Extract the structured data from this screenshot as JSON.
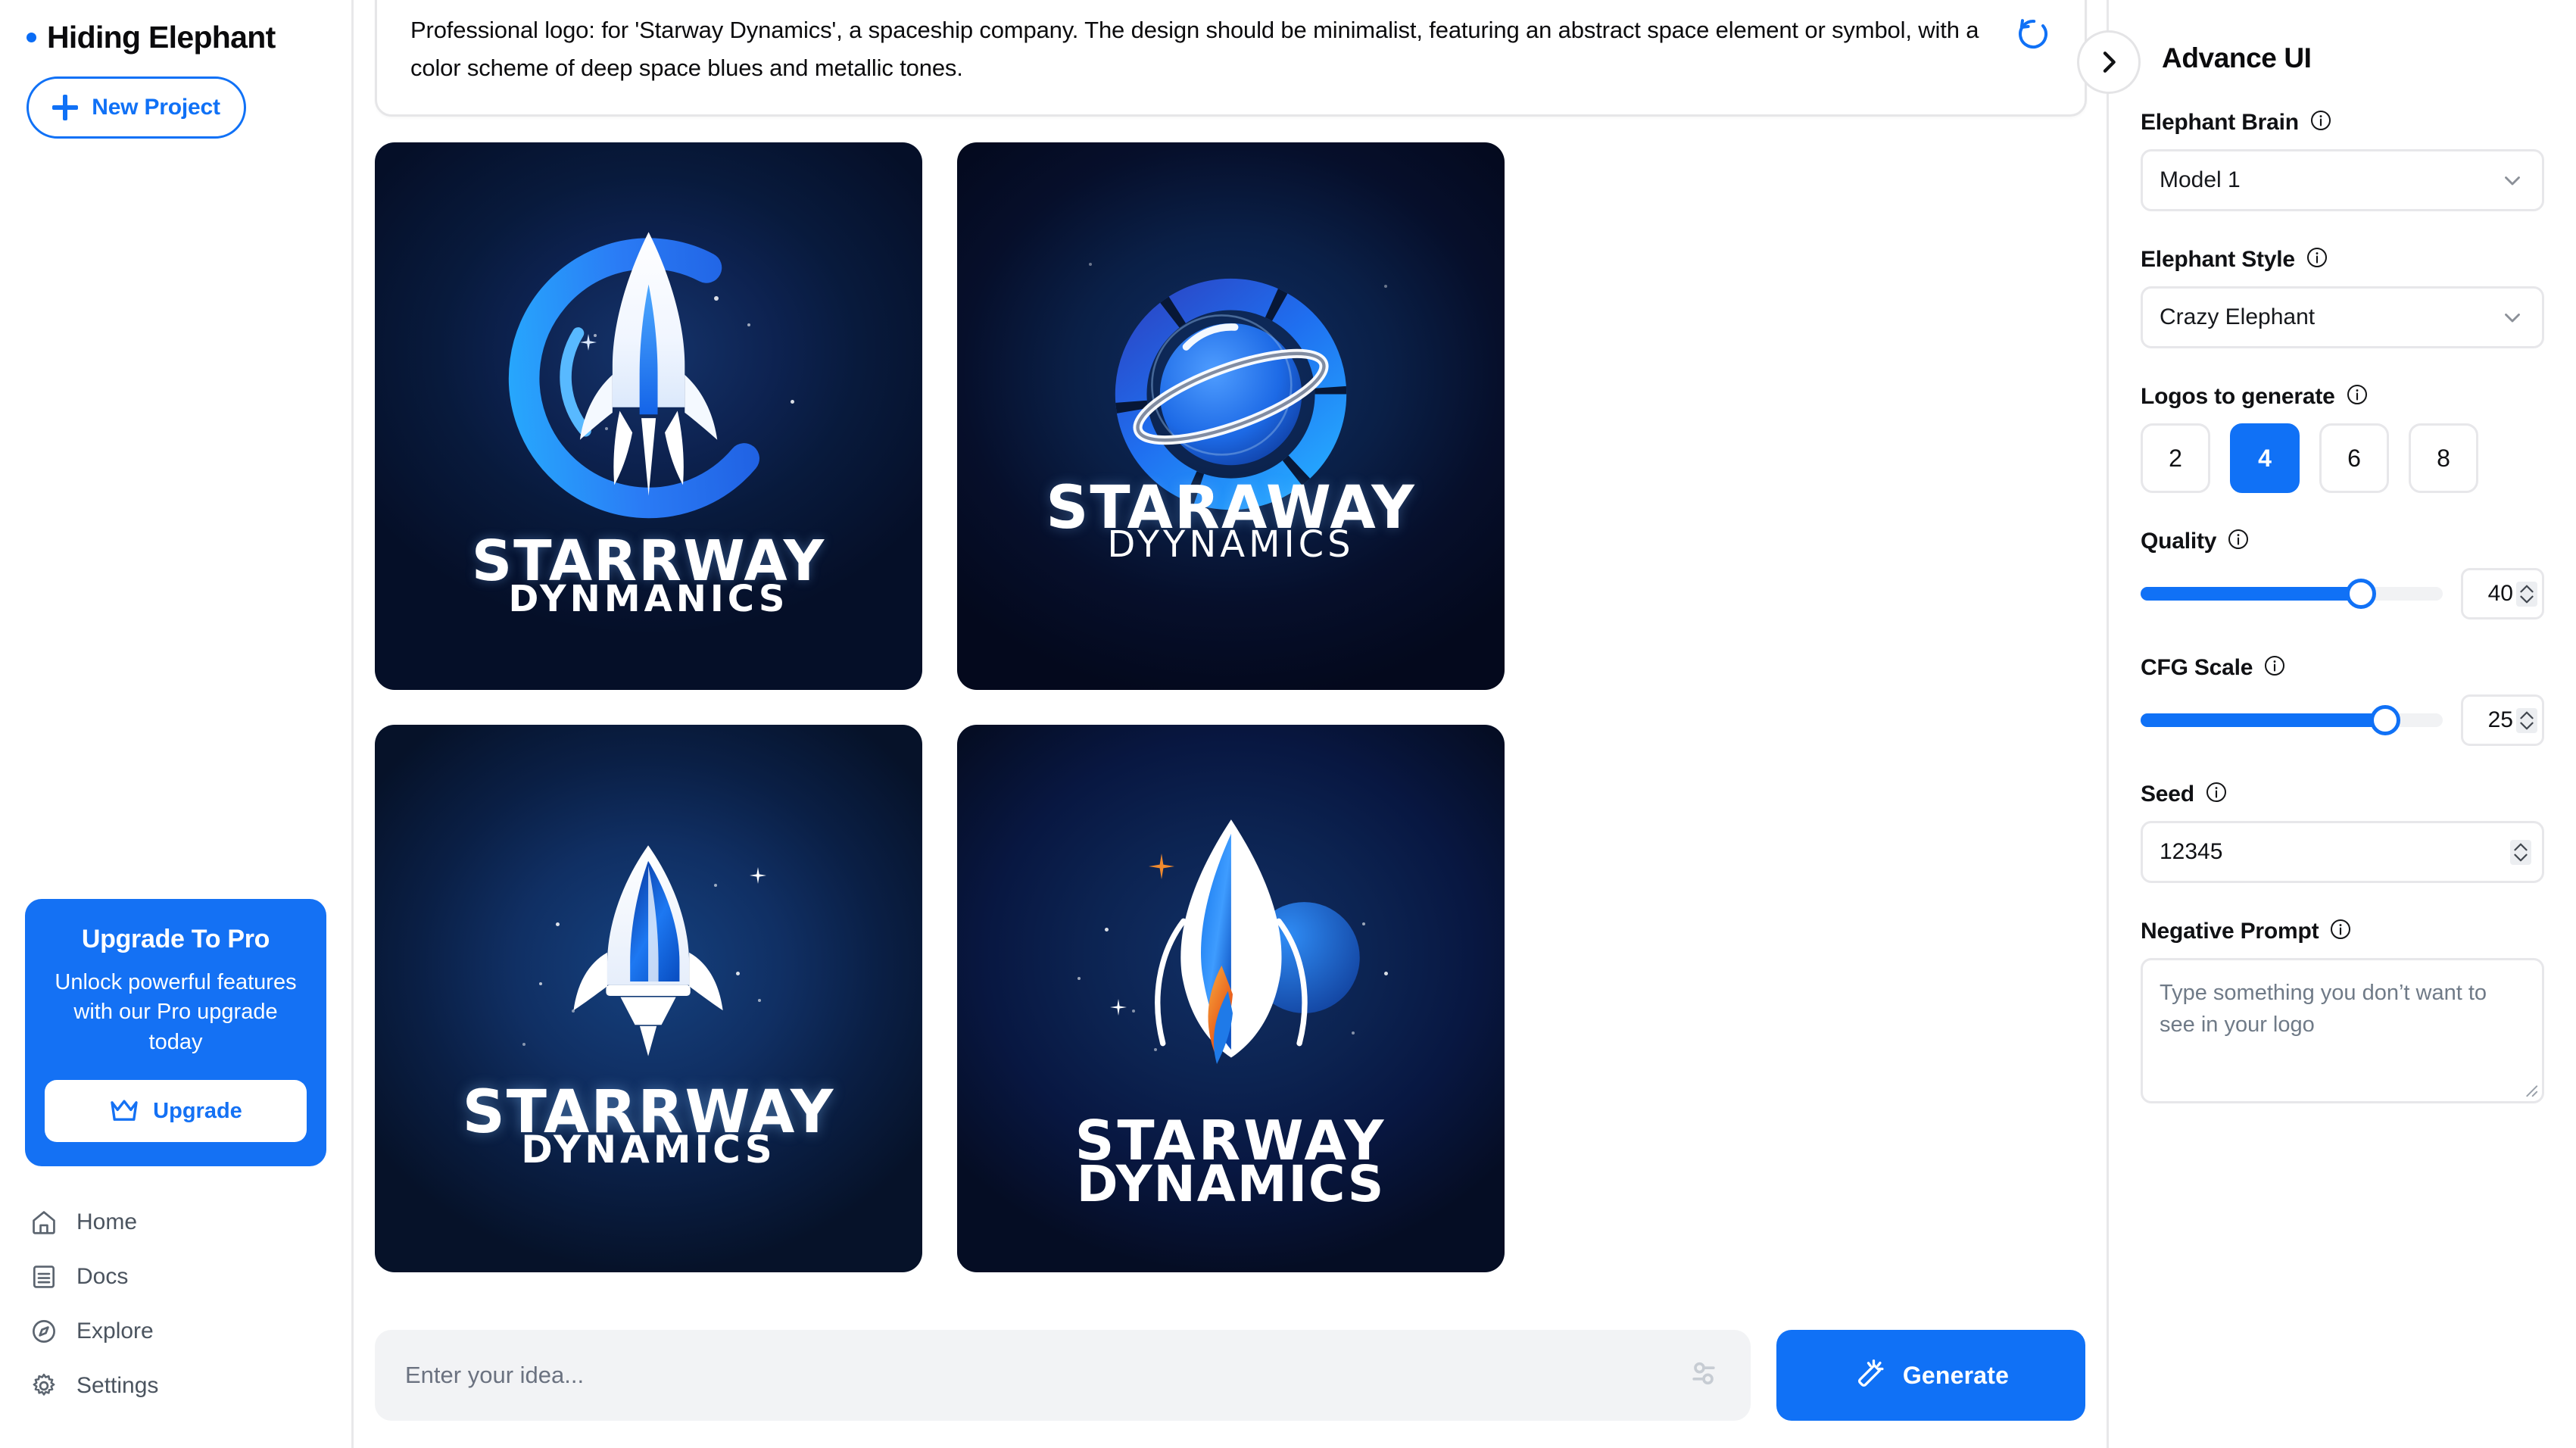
{
  "sidebar": {
    "brand": "Hiding Elephant",
    "new_project_label": "New Project",
    "upgrade": {
      "title": "Upgrade To Pro",
      "description": "Unlock powerful features with our Pro upgrade today",
      "button_label": "Upgrade"
    },
    "nav": [
      {
        "label": "Home",
        "icon": "home-icon"
      },
      {
        "label": "Docs",
        "icon": "docs-icon"
      },
      {
        "label": "Explore",
        "icon": "compass-icon"
      },
      {
        "label": "Settings",
        "icon": "gear-icon"
      }
    ]
  },
  "main": {
    "prompt_text": "Professional logo: for 'Starway Dynamics', a spaceship company. The design should be minimalist, featuring an abstract space element or symbol, with a color scheme of deep space blues and metallic tones.",
    "reset_icon": "reset-rotate-ccw-icon",
    "results": [
      {
        "wordmark_top": "STARRWAY",
        "wordmark_bottom": "DYNMANICS",
        "art": "rocket-crescent-ring"
      },
      {
        "wordmark_top": "STARAWAY",
        "wordmark_bottom": "DYYNAMICS",
        "art": "ringed-planet-orb"
      },
      {
        "wordmark_top": "STARRWAY",
        "wordmark_bottom": "DYNAMICS",
        "art": "slim-rocket-stars"
      },
      {
        "wordmark_top": "STARWAY",
        "wordmark_bottom": "DYNAMICS",
        "art": "flame-rocket-planet"
      }
    ],
    "idea_input": {
      "value": "",
      "placeholder": "Enter your idea...",
      "settings_icon": "sliders-icon"
    },
    "generate": {
      "label": "Generate",
      "icon": "magic-wand-icon"
    }
  },
  "right_panel": {
    "title": "Advance UI",
    "toggle_icon": "chevron-right-icon",
    "elephant_brain": {
      "label": "Elephant Brain",
      "value": "Model 1",
      "info_icon": "info-icon",
      "chevron": "chevron-down-icon"
    },
    "elephant_style": {
      "label": "Elephant Style",
      "value": "Crazy Elephant",
      "info_icon": "info-icon",
      "chevron": "chevron-down-icon"
    },
    "logos_to_generate": {
      "label": "Logos to generate",
      "info_icon": "info-icon",
      "options": [
        "2",
        "4",
        "6",
        "8"
      ],
      "selected": "4"
    },
    "quality": {
      "label": "Quality",
      "info_icon": "info-icon",
      "value": "40",
      "percent": 73
    },
    "cfg_scale": {
      "label": "CFG Scale",
      "info_icon": "info-icon",
      "value": "25",
      "percent": 81
    },
    "seed": {
      "label": "Seed",
      "info_icon": "info-icon",
      "value": "12345"
    },
    "negative_prompt": {
      "label": "Negative Prompt",
      "info_icon": "info-icon",
      "value": "",
      "placeholder": "Type something you don’t want to see in your logo"
    }
  },
  "colors": {
    "accent": "#1071f6",
    "accent_dark": "#0a6cf5",
    "panel_border": "#e8e8ea",
    "muted_text": "#6b7280"
  }
}
